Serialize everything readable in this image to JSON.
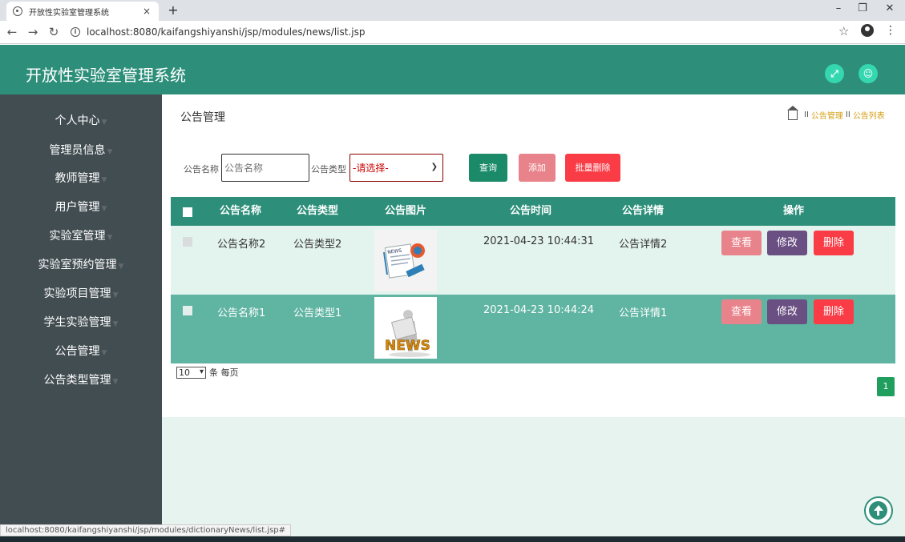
{
  "browser": {
    "tab_title": "开放性实验室管理系统",
    "tab_close": "×",
    "new_tab": "+",
    "url": "localhost:8080/kaifangshiyanshi/jsp/modules/news/list.jsp",
    "status_url": "localhost:8080/kaifangshiyanshi/jsp/modules/dictionaryNews/list.jsp#"
  },
  "app": {
    "title": "开放性实验室管理系统",
    "accent": "#2d8f7a"
  },
  "sidebar": {
    "items": [
      {
        "label": "个人中心"
      },
      {
        "label": "管理员信息"
      },
      {
        "label": "教师管理"
      },
      {
        "label": "用户管理"
      },
      {
        "label": "实验室管理"
      },
      {
        "label": "实验室预约管理"
      },
      {
        "label": "实验项目管理"
      },
      {
        "label": "学生实验管理"
      },
      {
        "label": "公告管理"
      },
      {
        "label": "公告类型管理"
      }
    ]
  },
  "page": {
    "title": "公告管理",
    "breadcrumb": {
      "sep": "II",
      "items": [
        "公告管理",
        "公告列表"
      ]
    }
  },
  "search": {
    "name_label": "公告名称",
    "name_placeholder": "公告名称",
    "type_label": "公告类型",
    "type_selected": "-请选择-",
    "query_btn": "查询",
    "add_btn": "添加",
    "batch_delete_btn": "批量删除"
  },
  "table": {
    "columns": [
      "公告名称",
      "公告类型",
      "公告图片",
      "公告时间",
      "公告详情",
      "操作"
    ],
    "rows": [
      {
        "name": "公告名称2",
        "type": "公告类型2",
        "time": "2021-04-23 10:44:31",
        "detail": "公告详情2"
      },
      {
        "name": "公告名称1",
        "type": "公告类型1",
        "time": "2021-04-23 10:44:24",
        "detail": "公告详情1"
      }
    ],
    "actions": {
      "view": "查看",
      "edit": "修改",
      "delete": "删除"
    }
  },
  "pager": {
    "page_size": "10",
    "per_page_text": "条 每页",
    "current_page": "1"
  }
}
